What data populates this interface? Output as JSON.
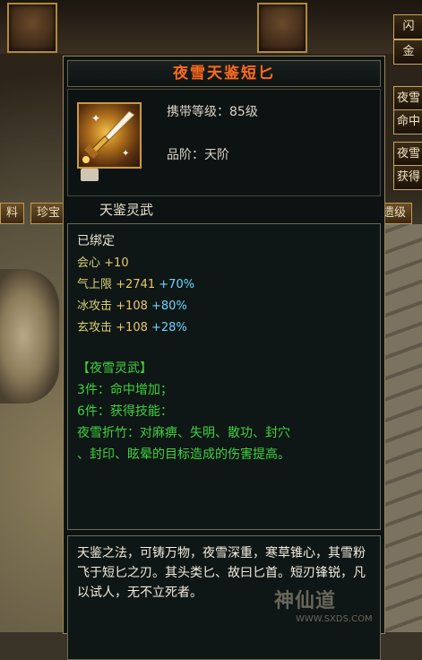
{
  "background": {
    "tabs": [
      "料",
      "珍宝",
      "遗级"
    ],
    "right_buttons": [
      "闪",
      "金",
      "夜雪",
      "命中",
      "夜雪",
      "获得"
    ]
  },
  "tooltip": {
    "title": "夜雪天鉴短匕",
    "carry_level": "携带等级：85级",
    "grade": "品阶：天阶",
    "set_name": "天鉴灵武",
    "bound": "已绑定",
    "stats": [
      {
        "label": "会心",
        "value": "+10",
        "pct": ""
      },
      {
        "label": "气上限",
        "value": "+2741",
        "pct": "+70%"
      },
      {
        "label": "冰攻击",
        "value": "+108",
        "pct": "+80%"
      },
      {
        "label": "玄攻击",
        "value": "+108",
        "pct": "+28%"
      }
    ],
    "set_bonus": {
      "header": "【夜雪灵武】",
      "line1": "3件：命中增加；",
      "line2": "6件：获得技能：",
      "line3": "夜雪折竹：对麻痹、失明、散功、封穴",
      "line4": "、封印、眩晕的目标造成的伤害提高。"
    },
    "description": "天鉴之法，可铸万物，夜雪深重，寒草锥心，其雪粉飞于短匕之刃。其头类匕、故曰匕首。短刃锋锐，凡以试人，无不立死者。"
  },
  "watermark": {
    "text": "神仙道",
    "url": "WWW.SXDS.COM"
  },
  "colors": {
    "title": "#ff6a1a",
    "bound": "#e9e2cf",
    "stat_label": "#d8cf73",
    "value": "#e9c86a",
    "percent": "#6fd6ff",
    "set_green": "#3fd23f"
  }
}
